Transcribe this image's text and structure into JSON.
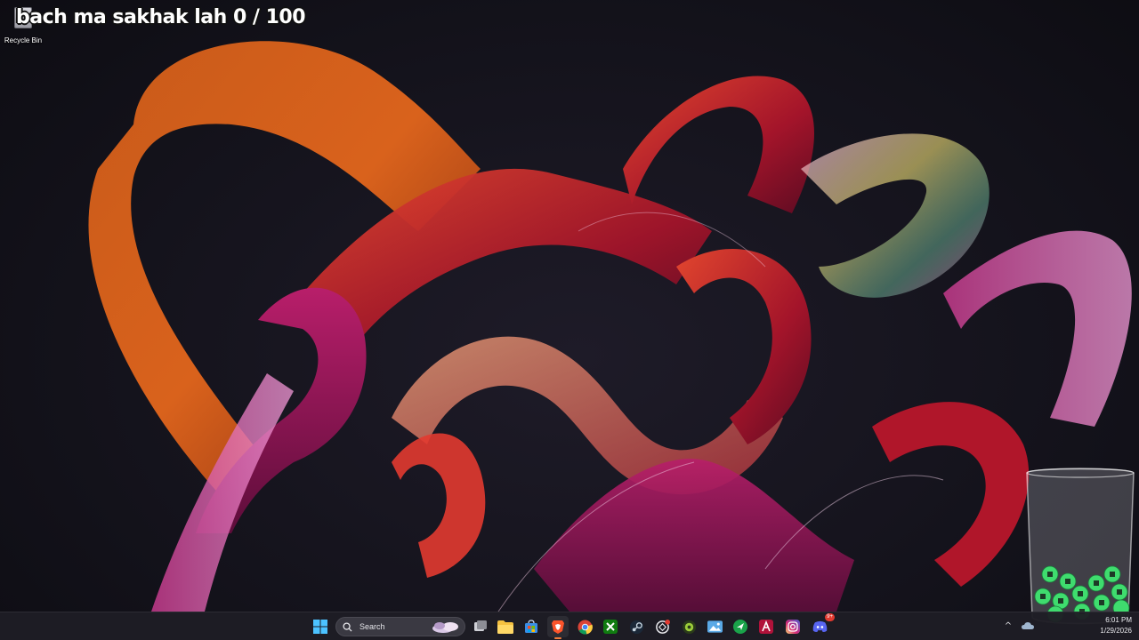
{
  "desktop": {
    "recycle_bin_label": "Recycle Bin",
    "overlay_text": "bach ma sakhak lah 0 / 100"
  },
  "taskbar": {
    "search_placeholder": "Search",
    "apps": [
      {
        "name": "start",
        "icon": "windows-icon"
      },
      {
        "name": "search",
        "icon": "search-icon"
      },
      {
        "name": "task-view",
        "icon": "task-view-icon"
      },
      {
        "name": "file-explorer",
        "icon": "folder-icon"
      },
      {
        "name": "microsoft-store",
        "icon": "store-icon"
      },
      {
        "name": "brave",
        "icon": "brave-icon"
      },
      {
        "name": "chrome",
        "icon": "chrome-icon"
      },
      {
        "name": "xbox",
        "icon": "xbox-icon"
      },
      {
        "name": "steam",
        "icon": "steam-icon"
      },
      {
        "name": "chatgpt",
        "icon": "openai-icon"
      },
      {
        "name": "osu",
        "icon": "game-icon"
      },
      {
        "name": "photos",
        "icon": "photos-icon"
      },
      {
        "name": "app-arrow",
        "icon": "arrow-app-icon"
      },
      {
        "name": "app-a",
        "icon": "letter-a-app-icon"
      },
      {
        "name": "instagram",
        "icon": "instagram-icon"
      },
      {
        "name": "discord",
        "icon": "discord-icon"
      }
    ],
    "discord_badge": "9+",
    "tray": {
      "chevron": "^",
      "time": "6:01 PM",
      "date": "1/29/2026"
    }
  },
  "colors": {
    "accent": "#f07b3c",
    "taskbar_bg": "#1e1d24",
    "wallpaper_bg": "#121119"
  }
}
